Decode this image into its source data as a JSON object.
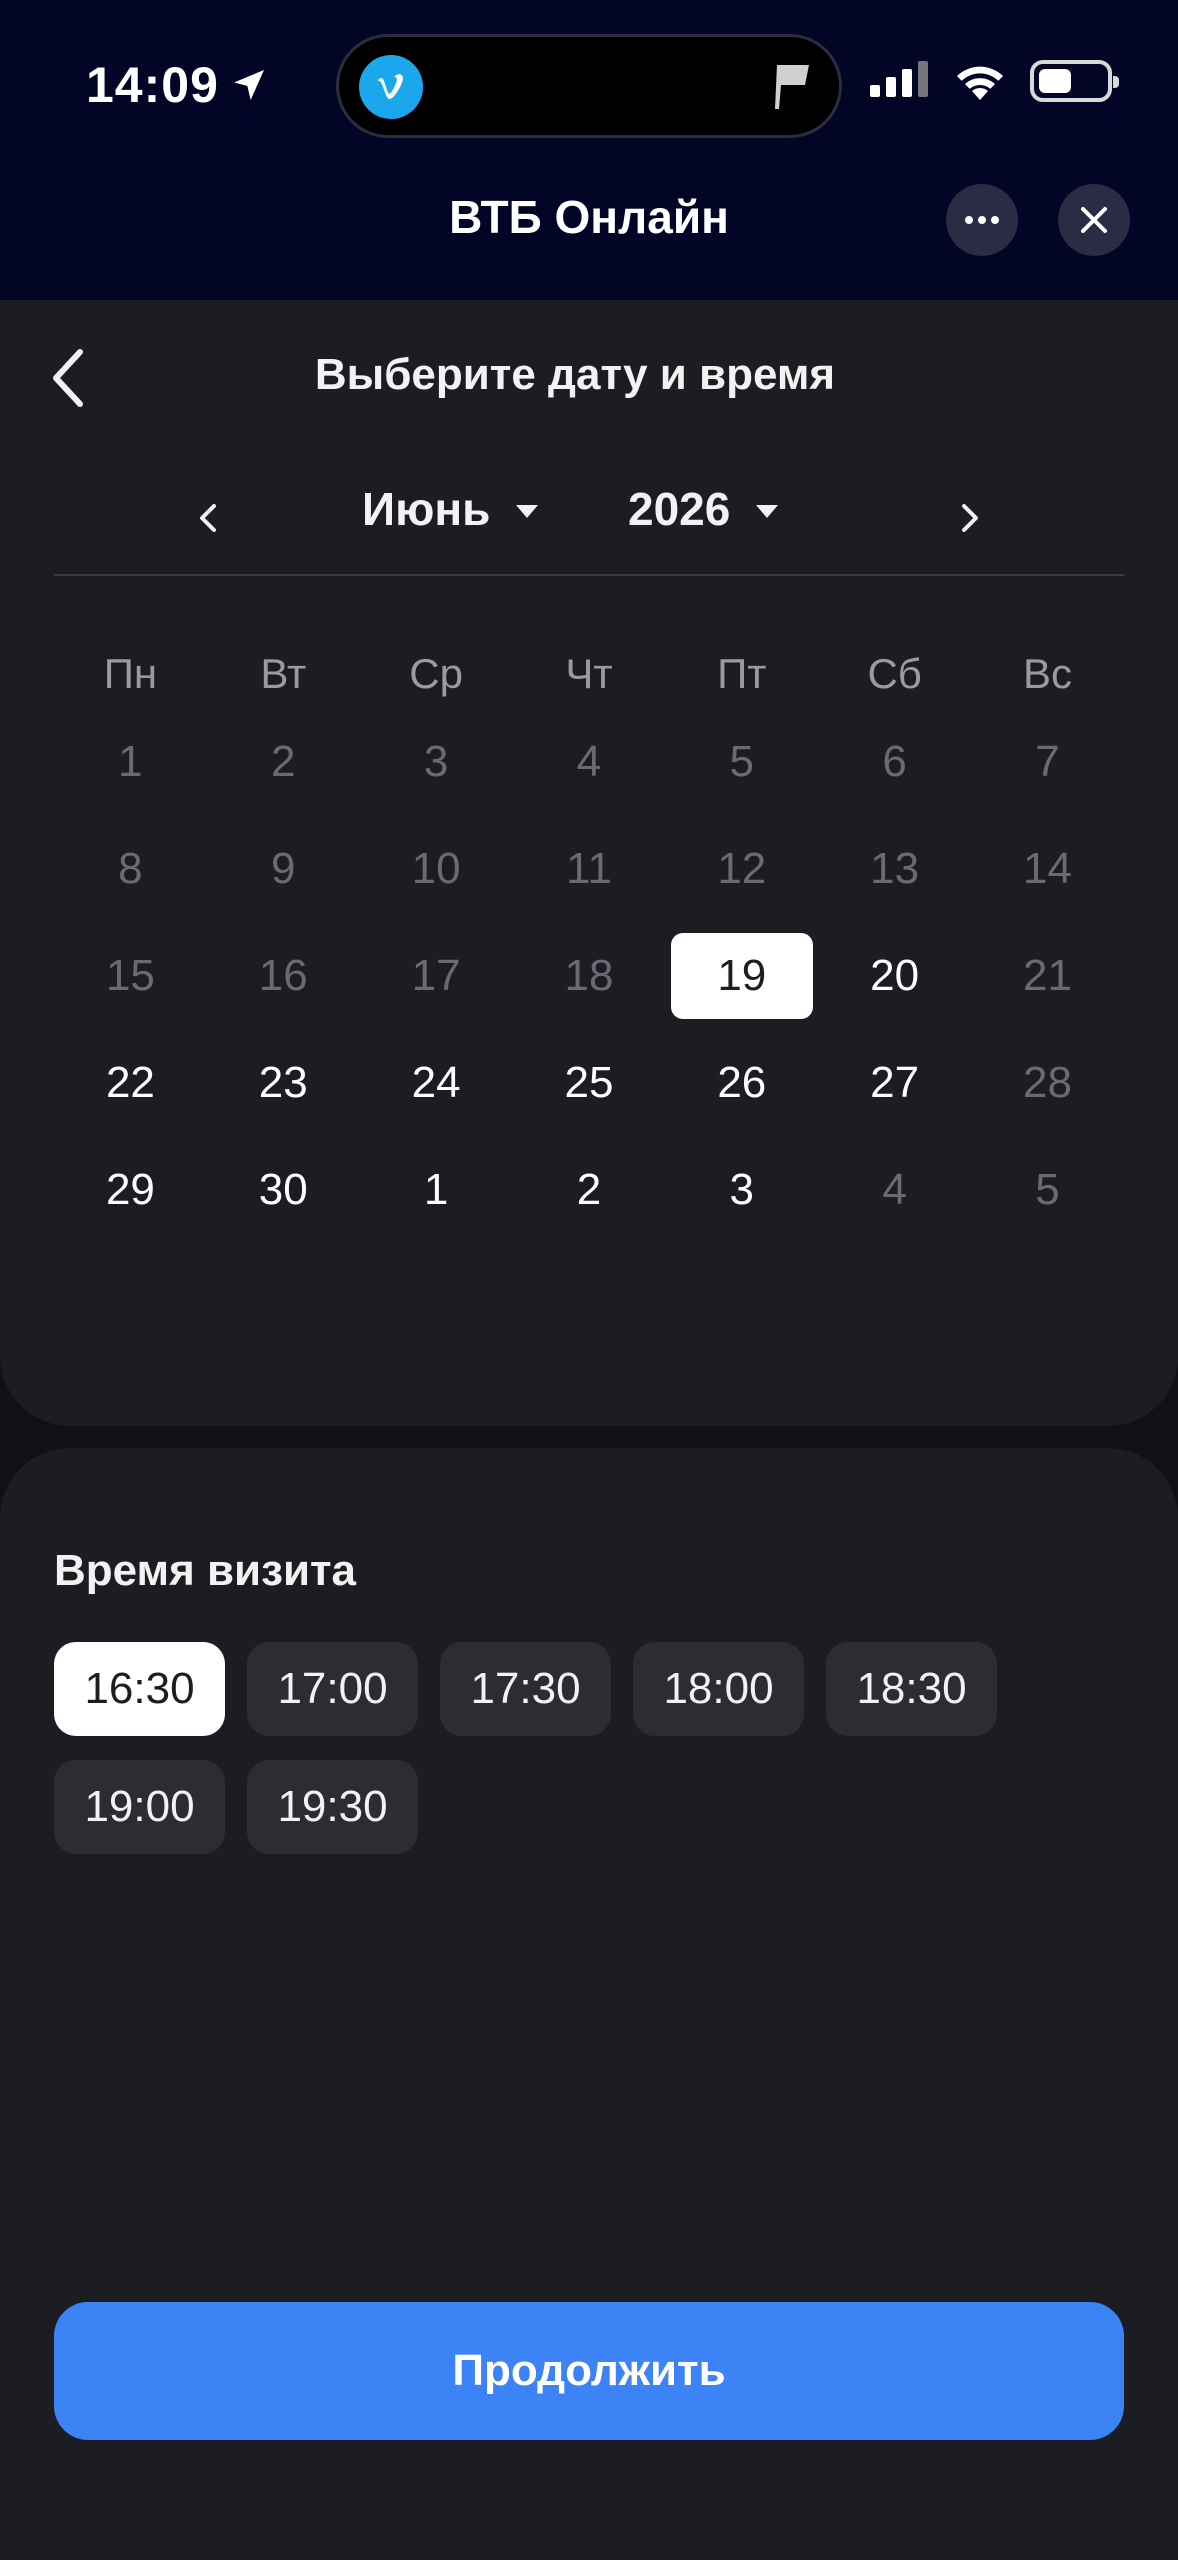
{
  "status_bar": {
    "time": "14:09"
  },
  "app_bar": {
    "title": "ВТБ Онлайн"
  },
  "screen": {
    "title": "Выберите дату и время"
  },
  "calendar": {
    "month": "Июнь",
    "year": "2026",
    "weekdays": [
      "Пн",
      "Вт",
      "Ср",
      "Чт",
      "Пт",
      "Сб",
      "Вс"
    ],
    "weeks": [
      [
        {
          "d": "1",
          "s": "muted"
        },
        {
          "d": "2",
          "s": "muted"
        },
        {
          "d": "3",
          "s": "muted"
        },
        {
          "d": "4",
          "s": "muted"
        },
        {
          "d": "5",
          "s": "muted"
        },
        {
          "d": "6",
          "s": "muted"
        },
        {
          "d": "7",
          "s": "muted"
        }
      ],
      [
        {
          "d": "8",
          "s": "muted"
        },
        {
          "d": "9",
          "s": "muted"
        },
        {
          "d": "10",
          "s": "muted"
        },
        {
          "d": "11",
          "s": "muted"
        },
        {
          "d": "12",
          "s": "muted"
        },
        {
          "d": "13",
          "s": "muted"
        },
        {
          "d": "14",
          "s": "muted"
        }
      ],
      [
        {
          "d": "15",
          "s": "muted"
        },
        {
          "d": "16",
          "s": "muted"
        },
        {
          "d": "17",
          "s": "muted"
        },
        {
          "d": "18",
          "s": "muted"
        },
        {
          "d": "19",
          "s": "selected"
        },
        {
          "d": "20",
          "s": "active"
        },
        {
          "d": "21",
          "s": "muted"
        }
      ],
      [
        {
          "d": "22",
          "s": "active"
        },
        {
          "d": "23",
          "s": "active"
        },
        {
          "d": "24",
          "s": "active"
        },
        {
          "d": "25",
          "s": "active"
        },
        {
          "d": "26",
          "s": "active"
        },
        {
          "d": "27",
          "s": "active"
        },
        {
          "d": "28",
          "s": "muted"
        }
      ],
      [
        {
          "d": "29",
          "s": "active"
        },
        {
          "d": "30",
          "s": "active"
        },
        {
          "d": "1",
          "s": "active"
        },
        {
          "d": "2",
          "s": "active"
        },
        {
          "d": "3",
          "s": "active"
        },
        {
          "d": "4",
          "s": "muted"
        },
        {
          "d": "5",
          "s": "muted"
        }
      ]
    ]
  },
  "visit_time": {
    "label": "Время визита",
    "slots": [
      "16:30",
      "17:00",
      "17:30",
      "18:00",
      "18:30",
      "19:00",
      "19:30"
    ],
    "selected_index": 0
  },
  "continue_button": {
    "label": "Продолжить"
  },
  "colors": {
    "primary": "#3c84f6",
    "header_bg": "#030526",
    "card_bg": "#1c1d22",
    "app_icon": "#1aa7ec"
  }
}
